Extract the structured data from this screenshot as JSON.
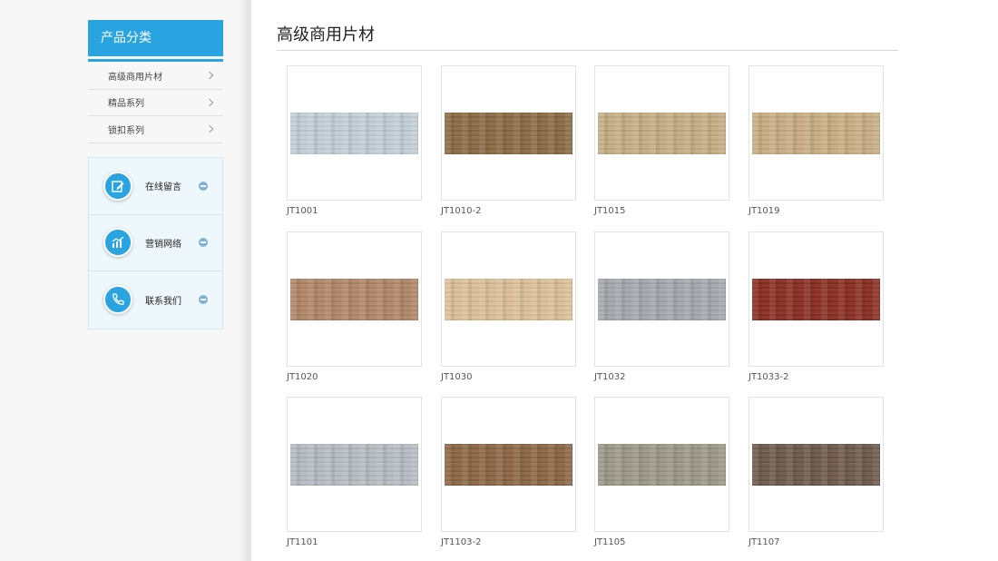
{
  "sidebar": {
    "header": "产品分类",
    "categories": [
      {
        "label": "高级商用片材"
      },
      {
        "label": "精品系列"
      },
      {
        "label": "锁扣系列"
      }
    ],
    "contacts": [
      {
        "label": "在线留言",
        "icon": "edit-icon"
      },
      {
        "label": "营销网络",
        "icon": "chart-icon"
      },
      {
        "label": "联系我们",
        "icon": "phone-icon"
      }
    ]
  },
  "main": {
    "title": "高级商用片材",
    "products": [
      {
        "code": "JT1001",
        "color": "#c3cdd6"
      },
      {
        "code": "JT1010-2",
        "color": "#8a6a44"
      },
      {
        "code": "JT1015",
        "color": "#c4ad84"
      },
      {
        "code": "JT1019",
        "color": "#c7ad84"
      },
      {
        "code": "JT1020",
        "color": "#b08668"
      },
      {
        "code": "JT1030",
        "color": "#dbbf98"
      },
      {
        "code": "JT1032",
        "color": "#a5a7ad"
      },
      {
        "code": "JT1033-2",
        "color": "#8a2e24"
      },
      {
        "code": "JT1101",
        "color": "#b6bcc2"
      },
      {
        "code": "JT1103-2",
        "color": "#8d6644"
      },
      {
        "code": "JT1105",
        "color": "#9c9888"
      },
      {
        "code": "JT1107",
        "color": "#6e5a4c"
      }
    ]
  },
  "colors": {
    "accent": "#2aa4e0"
  }
}
